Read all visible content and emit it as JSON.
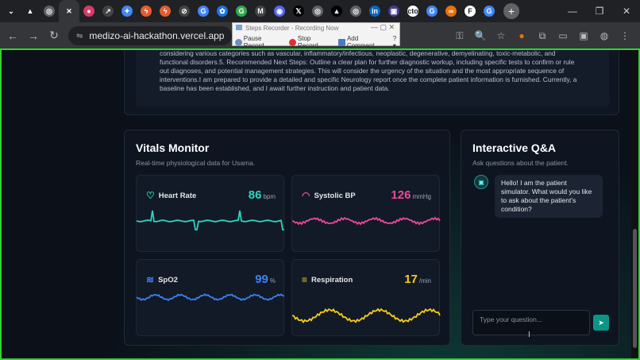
{
  "browser": {
    "tabs": [
      {
        "icon": "chevron-down-icon",
        "glyph": "⌄",
        "color": "#202124"
      },
      {
        "icon": "triangle-logo-icon",
        "glyph": "▲",
        "color": "#202124"
      },
      {
        "icon": "globe-icon",
        "glyph": "◎",
        "color": "#5f6368"
      },
      {
        "icon": "close-icon",
        "glyph": "✕",
        "color": "#35363a",
        "active": true
      },
      {
        "icon": "circle-logo-icon",
        "glyph": "●",
        "color": "#d93a6a"
      },
      {
        "icon": "share-icon",
        "glyph": "↗",
        "color": "#444"
      },
      {
        "icon": "sparkle-icon",
        "glyph": "✦",
        "color": "#4285f4"
      },
      {
        "icon": "bolt-icon",
        "glyph": "ϟ",
        "color": "#e65c2f"
      },
      {
        "icon": "bolt-icon",
        "glyph": "ϟ",
        "color": "#e65c2f"
      },
      {
        "icon": "slash-circle-icon",
        "glyph": "⊘",
        "color": "#444"
      },
      {
        "icon": "google-icon",
        "glyph": "G",
        "color": "#4285f4"
      },
      {
        "icon": "puzzle-icon",
        "glyph": "✿",
        "color": "#1a73e8"
      },
      {
        "icon": "google-icon",
        "glyph": "G",
        "color": "#34a853"
      },
      {
        "icon": "m-circle-icon",
        "glyph": "M",
        "color": "#444"
      },
      {
        "icon": "discord-icon",
        "glyph": "◉",
        "color": "#5865f2"
      },
      {
        "icon": "x-logo-icon",
        "glyph": "𝕏",
        "color": "#000"
      },
      {
        "icon": "globe-icon",
        "glyph": "◎",
        "color": "#5f6368"
      },
      {
        "icon": "triangle-logo-icon",
        "glyph": "▲",
        "color": "#000"
      },
      {
        "icon": "globe-icon",
        "glyph": "◎",
        "color": "#5f6368"
      },
      {
        "icon": "linkedin-icon",
        "glyph": "in",
        "color": "#0a66c2"
      },
      {
        "icon": "image-icon",
        "glyph": "▣",
        "color": "#4a3c8c"
      },
      {
        "icon": "cto-icon",
        "glyph": "cto",
        "color": "#fff"
      },
      {
        "icon": "google-icon",
        "glyph": "G",
        "color": "#4285f4"
      },
      {
        "icon": "infinity-icon",
        "glyph": "∞",
        "color": "#e8710a"
      },
      {
        "icon": "f-logo-icon",
        "glyph": "F",
        "color": "#fff"
      },
      {
        "icon": "google-icon",
        "glyph": "G",
        "color": "#4285f4"
      }
    ],
    "new_tab_label": "+",
    "window_controls": [
      "—",
      "❐",
      "✕"
    ],
    "url": "medizo-ai-hackathon.vercel.app",
    "nav": {
      "back": "←",
      "forward": "→",
      "reload": "↻",
      "site_info": "⇋"
    },
    "right_tools": [
      "⚿",
      "🔍",
      "☆",
      "●",
      "⧉",
      "▭",
      "▣",
      "◍",
      "⋮"
    ]
  },
  "steps_recorder": {
    "title": "Steps Recorder - Recording Now",
    "pause_label": "Pause Record",
    "stop_label": "Stop Record",
    "comment_label": "Add Comment",
    "help_label": "?▾"
  },
  "report": {
    "text": "considering various categories such as vascular, inflammatory/infectious, neoplastic, degenerative, demyelinating, toxic-metabolic, and functional disorders.5. Recommended Next Steps: Outline a clear plan for further diagnostic workup, including specific tests to confirm or rule out diagnoses, and potential management strategies. This will consider the urgency of the situation and the most appropriate sequence of interventions.I am prepared to provide a detailed and specific Neurology report once the complete patient information is furnished. Currently, a baseline has been established, and I await further instruction and patient data."
  },
  "vitals": {
    "title": "Vitals Monitor",
    "subtitle": "Real-time physiological data for Usama.",
    "cards": [
      {
        "name": "heart-rate",
        "label": "Heart Rate",
        "value": "86",
        "unit": "bpm",
        "color": "#2dd4bf",
        "icon": "heart-icon"
      },
      {
        "name": "systolic-bp",
        "label": "Systolic BP",
        "value": "126",
        "unit": "mmHg",
        "color": "#ec4899",
        "icon": "gauge-icon"
      },
      {
        "name": "spo2",
        "label": "SpO2",
        "value": "99",
        "unit": "%",
        "color": "#3b82f6",
        "icon": "waves-icon"
      },
      {
        "name": "respiration",
        "label": "Respiration",
        "value": "17",
        "unit": "/min",
        "color": "#facc15",
        "icon": "wind-icon"
      }
    ]
  },
  "qa": {
    "title": "Interactive Q&A",
    "subtitle": "Ask questions about the patient.",
    "bot_message": "Hello! I am the patient simulator. What would you like to ask about the patient's condition?",
    "input_placeholder": "Type your question...",
    "send_icon": "send-icon"
  }
}
